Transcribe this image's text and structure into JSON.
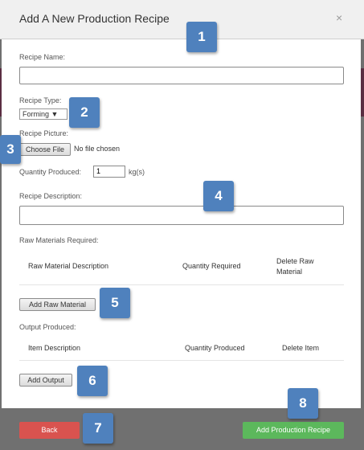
{
  "modal": {
    "title": "Add A New Production Recipe",
    "close_glyph": "×"
  },
  "form": {
    "recipe_name_label": "Recipe Name:",
    "recipe_name_value": "",
    "recipe_type_label": "Recipe Type:",
    "recipe_type_selected": "Forming ▼",
    "recipe_picture_label": "Recipe Picture:",
    "choose_file_label": "Choose File",
    "no_file_text": "No file chosen",
    "quantity_label": "Quantity Produced:",
    "quantity_value": "1",
    "quantity_unit": "kg(s)",
    "description_label": "Recipe Description:",
    "description_value": ""
  },
  "raw_materials": {
    "section_label": "Raw Materials Required:",
    "columns": [
      "Raw Material Description",
      "Quantity Required",
      "Delete Raw",
      "Material"
    ],
    "add_button": "Add Raw Material"
  },
  "output": {
    "section_label": "Output Produced:",
    "columns": [
      "Item Description",
      "Quantity Produced",
      "Delete Item"
    ],
    "add_button": "Add Output"
  },
  "footer": {
    "back_label": "Back",
    "submit_label": "Add Production Recipe"
  },
  "markers": [
    "1",
    "2",
    "3",
    "4",
    "5",
    "6",
    "7",
    "8"
  ],
  "colors": {
    "marker_blue": "#4f81bd",
    "back_red": "#d9534f",
    "submit_green": "#5cb85c"
  }
}
